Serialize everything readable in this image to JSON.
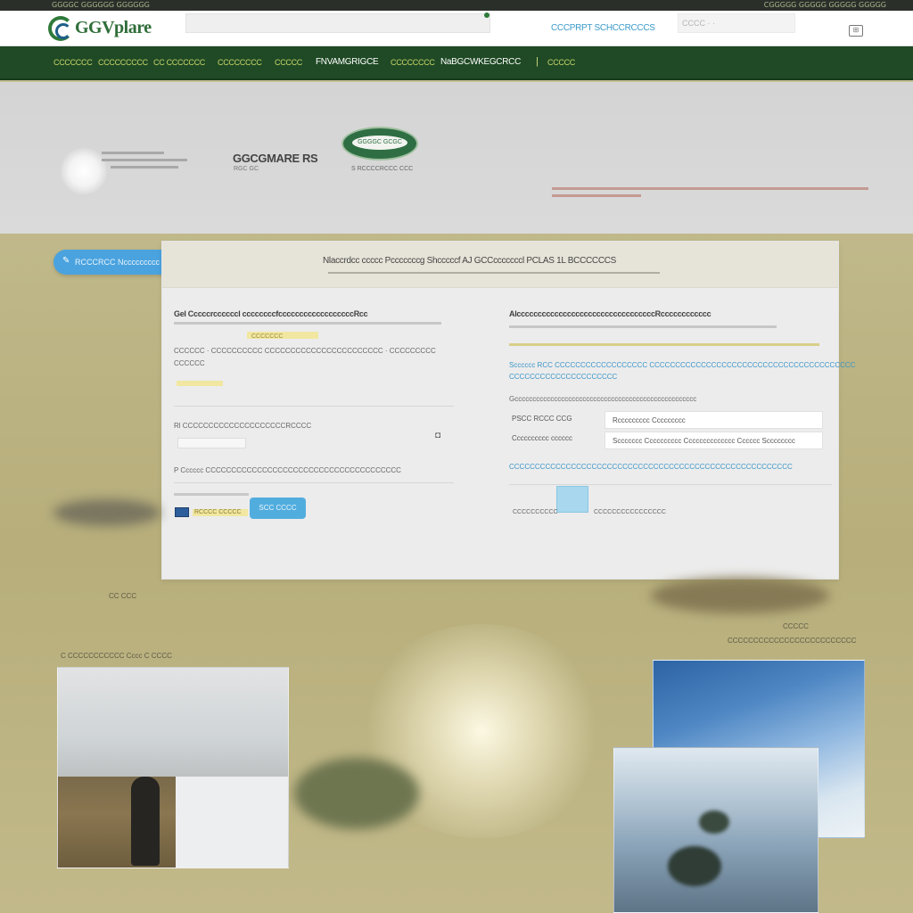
{
  "top_strip": {
    "left_text": "GGGGC GGGGGG GGGGGG",
    "right_text": "CGGGGG GGGGG GGGGG GGGGG"
  },
  "header": {
    "logo_text": "GGVplare",
    "search_placeholder": "",
    "links": "CCCPRPT SCHCCRCCCS",
    "input_value": "CCCC  ·  ·",
    "cart_icon": "cart-icon"
  },
  "nav": {
    "items": [
      "CCCCCCC",
      "CCCCCCCCC",
      "CC CCCCCCC",
      "CCCCCCCC",
      "CCCCC",
      "FNVAMGRIGCE",
      "CCCCCCCC",
      "NaBGCWKEGCRCC",
      "CCCCC"
    ]
  },
  "hero": {
    "brand": "GGCGMARE RS",
    "brand_sub": "RGC GC",
    "pill_label": "GGGGC GCGC",
    "pill_caption": "S RCCCCRCCC CCC"
  },
  "pill_button": {
    "label": "RCCCRCC  Nccccccccc  Scccccccc  Sl  CCCCCCCC"
  },
  "panel": {
    "title": "Nlaccrdcc ccccc Pcccccccg  Shcccccf  AJ  GCCcccccccl  PCLAS  1L  BCCCCCCS",
    "left_heading": "Gel Cccccrccccccl ccccccccfccccccccccccccccccRcc",
    "left_link": "CCCCCCC",
    "left_row1": "CCCCCC  ·  CCCCCCCCCC  CCCCCCCCCCCCCCCCCCCCCCC  ·  CCCCCCCCC",
    "left_row2": "CCCCCC",
    "left_option_label": "Rl CCCCCCCCCCCCCCCCCCCCRCCCC",
    "left_option2": "P Cccccc CCCCCCCCCCCCCCCCCCCCCCCCCCCCCCCCCCCCCC",
    "left_small": "CCCCCCCCCCCCC",
    "left_btn_text": "RCCCC CCCCC",
    "submit_label": "SCC CCCC",
    "right_heading": "AlcccccccccccccccccccccccccccccccccRcccccccccccc",
    "right_link_row": "Scccccc RCC CCCCCCCCCCCCCCCCCC  CCCCCCCCCCCCCCCCCCCCCCCCCCCCCCCCCCCCCCCC",
    "right_link_row2": "CCCCCCCCCCCCCCCCCCCCC",
    "right_small_row": "Gccccccccccccccccccccccccccccccccccccccccccccccccccc",
    "field1_label": "PSCC RCCC CCG",
    "field1_value": "Rccccccccc Ccccccccc",
    "field2_label": "Cccccccccc cccccc",
    "field2_value": "Sccccccc  Cccccccccc  Cccccccccccccc  Cccccc  Scccccccc",
    "right_link_long": "CCCCCCCCCCCCCCCCCCCCCCCCCCCCCCCCCCCCCCCCCCCCCCCCCCCCCCC",
    "right_bottom_text": "CCCCCCCCCC",
    "right_bottom_text2": "CCCCCCCCCCCCCCCC"
  },
  "lower": {
    "caption_left": "C CCCCCCCCCCC Cccc C CCCC",
    "caption_right_top": "CCCCC",
    "caption_right": "CCCCCCCCCCCCCCCCCCCCCCCCC",
    "small_left": "CC CCC"
  },
  "colors": {
    "nav_bg": "#1f4a25",
    "accent_blue": "#4aa3df",
    "logo_green": "#2f6e39"
  }
}
